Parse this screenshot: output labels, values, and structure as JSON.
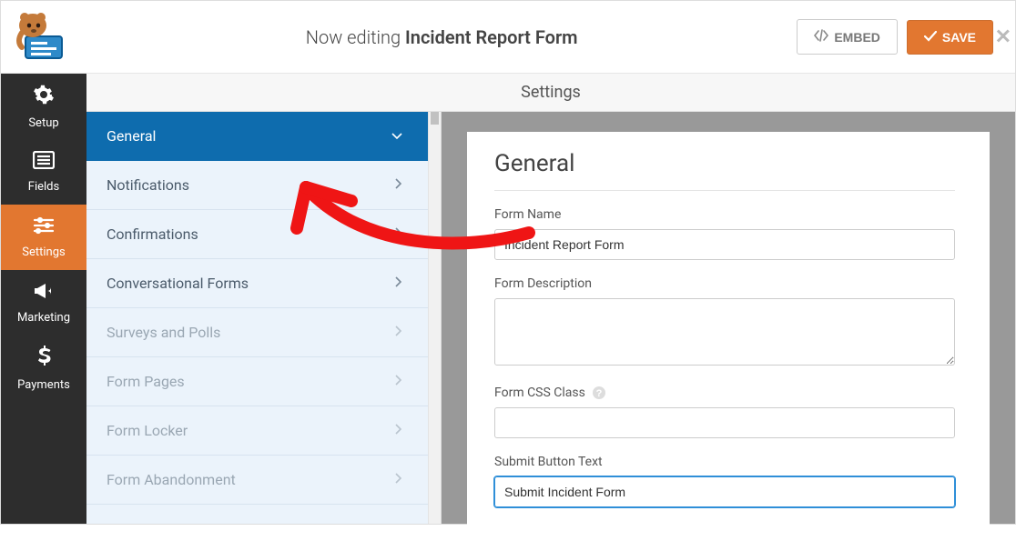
{
  "header": {
    "editing_prefix": "Now editing",
    "form_title": "Incident Report Form",
    "embed_label": "EMBED",
    "save_label": "SAVE"
  },
  "rail": {
    "setup": "Setup",
    "fields": "Fields",
    "settings": "Settings",
    "marketing": "Marketing",
    "payments": "Payments"
  },
  "subheader": {
    "title": "Settings"
  },
  "settings_nav": {
    "items": [
      {
        "label": "General",
        "active": true,
        "expandable": true
      },
      {
        "label": "Notifications",
        "active": false
      },
      {
        "label": "Confirmations",
        "active": false
      },
      {
        "label": "Conversational Forms",
        "active": false
      },
      {
        "label": "Surveys and Polls",
        "active": false,
        "disabled": true
      },
      {
        "label": "Form Pages",
        "active": false,
        "disabled": true
      },
      {
        "label": "Form Locker",
        "active": false,
        "disabled": true
      },
      {
        "label": "Form Abandonment",
        "active": false,
        "disabled": true
      }
    ]
  },
  "panel": {
    "heading": "General",
    "form_name_label": "Form Name",
    "form_name_value": "Incident Report Form",
    "form_description_label": "Form Description",
    "form_description_value": "",
    "form_css_label": "Form CSS Class",
    "form_css_value": "",
    "submit_text_label": "Submit Button Text",
    "submit_text_value": "Submit Incident Form"
  },
  "colors": {
    "accent": "#e27730",
    "nav_active": "#0e6cae"
  }
}
